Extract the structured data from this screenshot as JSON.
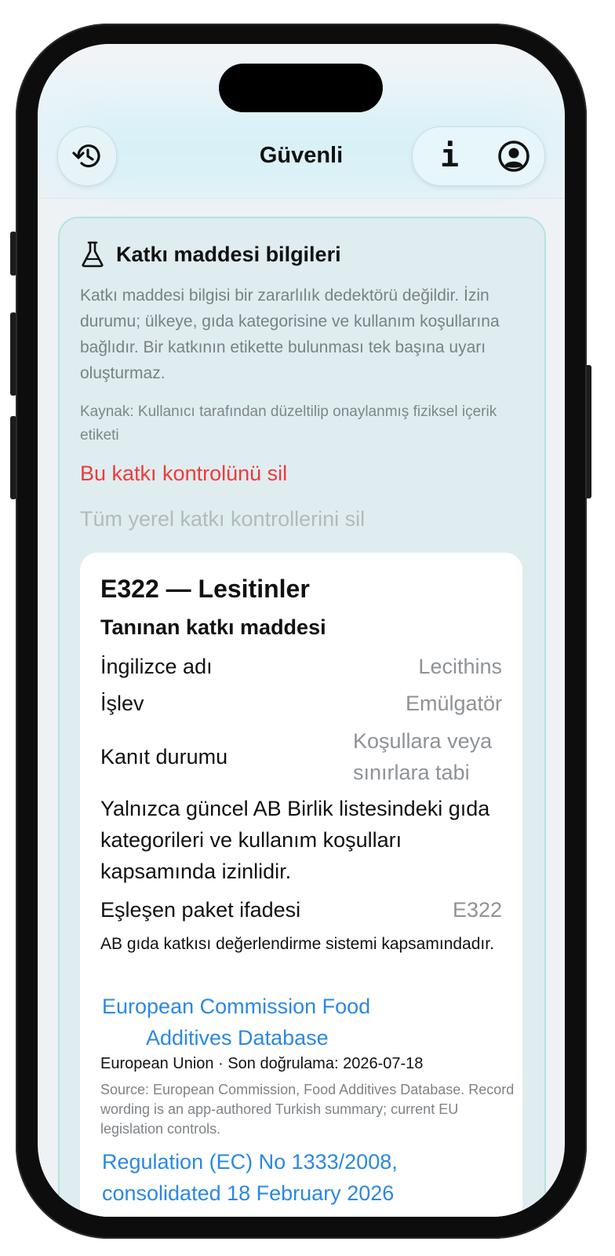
{
  "header": {
    "title": "Güvenli",
    "history_icon": "history-icon",
    "info_icon": "info-icon",
    "info_glyph": "i",
    "profile_icon": "profile-icon"
  },
  "panel": {
    "icon": "flask-icon",
    "title": "Katkı maddesi bilgileri",
    "description": "Katkı maddesi bilgisi bir zararlılık dedektörü değildir. İzin durumu; ülkeye, gıda kategorisine ve kullanım koşullarına bağlıdır. Bir katkının etikette bulunması tek başına uyarı oluşturmaz.",
    "source": "Kaynak: Kullanıcı tarafından düzeltilip onaylanmış fiziksel içerik etiketi",
    "delete_one": "Bu katkı kontrolünü sil",
    "delete_all": "Tüm yerel katkı kontrollerini sil"
  },
  "card": {
    "title": "E322 — Lesitinler",
    "subtitle": "Tanınan katkı maddesi",
    "english_name_label": "İngilizce adı",
    "english_name_value": "Lecithins",
    "function_label": "İşlev",
    "function_value": "Emülgatör",
    "evidence_label": "Kanıt durumu",
    "evidence_value": "Koşullara veya sınırlara tabi",
    "permission_text": "Yalnızca güncel AB Birlik listesindeki gıda kategorileri ve kullanım koşulları kapsamında izinlidir.",
    "match_label": "Eşleşen paket ifadesi",
    "match_value": "E322",
    "eu_system_text": "AB gıda katkısı değerlendirme sistemi kapsamındadır.",
    "link1_line1": "European Commission Food",
    "link1_line2": "Additives Database",
    "link1_meta": "European Union · Son doğrulama: 2026-07-18",
    "link1_note": "Source: European Commission, Food Additives Database. Record wording is an app-authored Turkish summary; current EU legislation controls.",
    "link2": "Regulation (EC) No 1333/2008, consolidated 18 February 2026"
  },
  "colors": {
    "accent_link": "#2b88e3",
    "destructive": "#f03a3a",
    "panel_bg": "#dfedf0",
    "panel_border": "#b3e3e3"
  }
}
